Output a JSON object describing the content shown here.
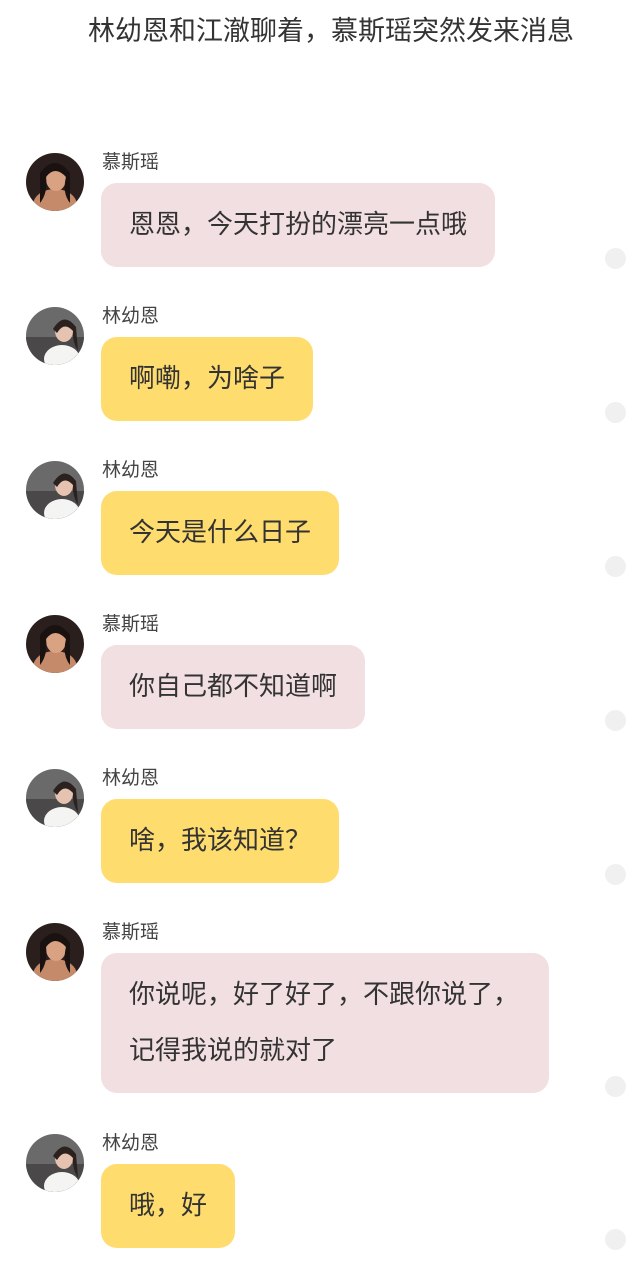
{
  "narration": "林幼恩和江澈聊着，慕斯瑶突然发来消息",
  "messages": [
    {
      "sender": "慕斯瑶",
      "avatar": "avatar-musiyao",
      "text": "恩恩，今天打扮的漂亮一点哦",
      "bubble_color": "#f2dfe1"
    },
    {
      "sender": "林幼恩",
      "avatar": "avatar-linyouen",
      "text": "啊嘞，为啥子",
      "bubble_color": "#fedc6e"
    },
    {
      "sender": "林幼恩",
      "avatar": "avatar-linyouen",
      "text": "今天是什么日子",
      "bubble_color": "#fedc6e"
    },
    {
      "sender": "慕斯瑶",
      "avatar": "avatar-musiyao",
      "text": "你自己都不知道啊",
      "bubble_color": "#f2dfe1"
    },
    {
      "sender": "林幼恩",
      "avatar": "avatar-linyouen",
      "text": "啥，我该知道？",
      "bubble_color": "#fedc6e"
    },
    {
      "sender": "慕斯瑶",
      "avatar": "avatar-musiyao",
      "text": "你说呢，好了好了，不跟你说了，记得我说的就对了",
      "bubble_color": "#f2dfe1"
    },
    {
      "sender": "林幼恩",
      "avatar": "avatar-linyouen",
      "text": "哦，好",
      "bubble_color": "#fedc6e"
    }
  ]
}
